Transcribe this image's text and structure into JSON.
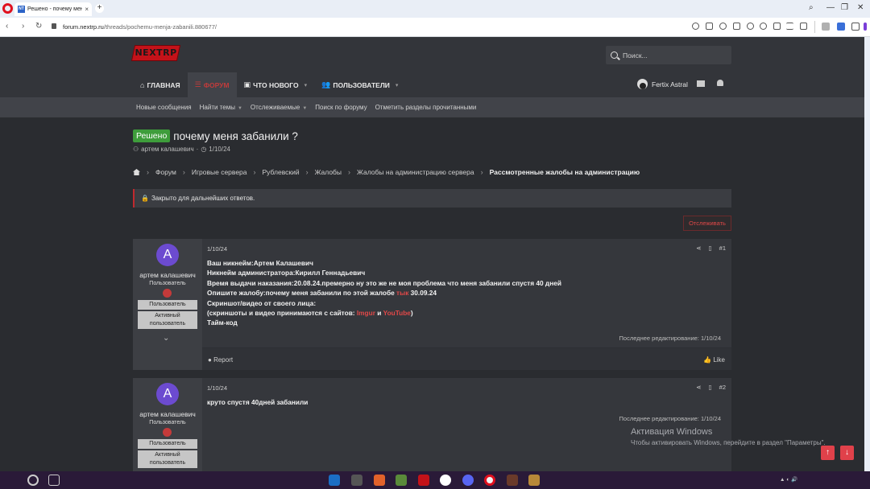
{
  "browser": {
    "tab_title": "Решено - почему меня з",
    "tab_favicon_text": "NT",
    "url_domain": "forum.nextrp.ru",
    "url_path": "/threads/pochemu-menja-zabanili.880677/"
  },
  "site": {
    "logo_text": "NEXTRP",
    "search_placeholder": "Поиск...",
    "nav": [
      {
        "label": "ГЛАВНАЯ",
        "icon": "home-icon",
        "glyph": "⌂"
      },
      {
        "label": "ФОРУМ",
        "icon": "forum-icon",
        "glyph": "☰"
      },
      {
        "label": "ЧТО НОВОГО",
        "icon": "news-icon",
        "glyph": "▣"
      },
      {
        "label": "ПОЛЬЗОВАТЕЛИ",
        "icon": "users-icon",
        "glyph": "👥"
      }
    ],
    "user_name": "Fertix Astral",
    "subnav": [
      "Новые сообщения",
      "Найти темы",
      "Отслеживаемые",
      "Поиск по форуму",
      "Отметить разделы прочитанными"
    ]
  },
  "thread": {
    "prefix": "Решено",
    "title": "почему меня забанили ?",
    "author": "артем калашевич",
    "date": "1/10/24",
    "breadcrumbs": [
      "Форум",
      "Игровые сервера",
      "Рублевский",
      "Жалобы",
      "Жалобы на администрацию сервера",
      "Рассмотренные жалобы на администрацию"
    ],
    "closed_notice": "Закрыто для дальнейших ответов.",
    "watch_label": "Отслеживать"
  },
  "posts": [
    {
      "avatar_letter": "A",
      "username": "артем калашевич",
      "role": "Пользователь",
      "chip1": "Пользователь",
      "chip2a": "Активный",
      "chip2b": "пользователь",
      "date": "1/10/24",
      "number": "#1",
      "lines": {
        "l1": "Ваш никнейм:Артем Калашевич",
        "l2": "Никнейм администратора:Кирилл Геннадьевич",
        "l3": "Время выдачи наказания:20.08.24.премерно ну это же не моя проблема что меня забанили спустя 40 дней",
        "l4a": "Опишите жалобу:почему меня забанили по этой жалобе ",
        "l4link": "тык",
        "l4b": " 30.09.24",
        "l5": "Скриншот/видео от своего лица:",
        "l6a": "(скриншоты и видео принимаются с сайтов: ",
        "l6link1": "Imgur",
        "l6mid": " и ",
        "l6link2": "YouTube",
        "l6b": ")",
        "l7": "Тайм-код"
      },
      "edited": "Последнее редактирование: 1/10/24",
      "report": "Report",
      "like": "Like"
    },
    {
      "avatar_letter": "A",
      "username": "артем калашевич",
      "role": "Пользователь",
      "chip1": "Пользователь",
      "chip2a": "Активный",
      "chip2b": "пользователь",
      "date": "1/10/24",
      "number": "#2",
      "text": "круто спустя 40дней забанили",
      "edited": "Последнее редактирование: 1/10/24"
    }
  ],
  "windows_activation": {
    "title": "Активация Windows",
    "subtitle": "Чтобы активировать Windows, перейдите в раздел \"Параметры\"."
  },
  "colors": {
    "accent_red": "#e04848",
    "solved_green": "#3e9d3b",
    "avatar_purple": "#6c4bd0"
  }
}
